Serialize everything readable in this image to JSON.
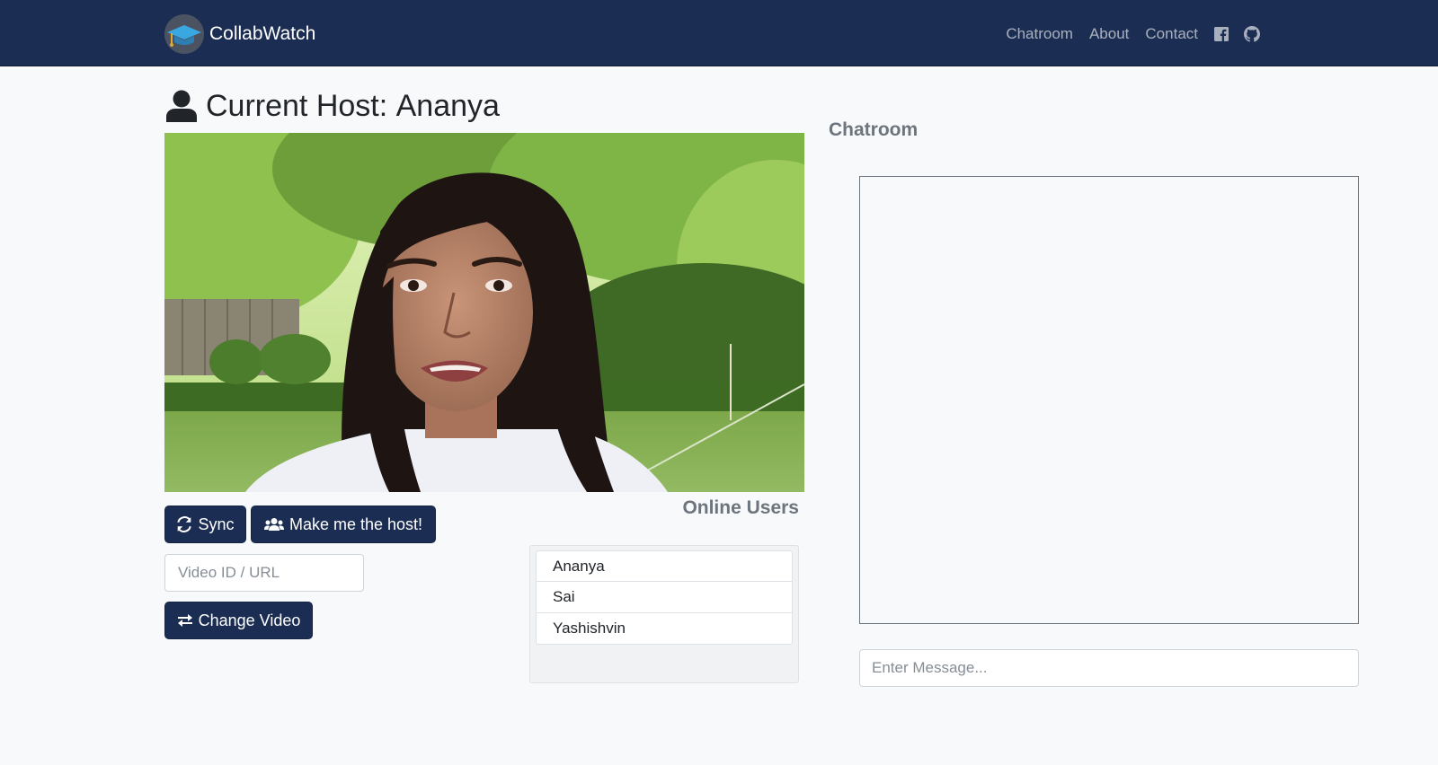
{
  "navbar": {
    "brand_name": "CollabWatch",
    "links": [
      "Chatroom",
      "About",
      "Contact"
    ],
    "icons": [
      "facebook-icon",
      "github-icon"
    ]
  },
  "host": {
    "prefix": "Current Host: ",
    "name": "Ananya",
    "icon": "person-icon"
  },
  "controls": {
    "sync_label": "Sync",
    "make_host_label": "Make me the host!",
    "video_input_placeholder": "Video ID / URL",
    "change_video_label": "Change Video"
  },
  "online_users": {
    "title": "Online Users",
    "users": [
      "Ananya",
      "Sai",
      "Yashishvin"
    ]
  },
  "chatroom": {
    "title": "Chatroom",
    "input_placeholder": "Enter Message..."
  },
  "colors": {
    "navbar": "#1b2d52",
    "button": "#1b2d52",
    "background": "#f8f9fa",
    "muted_heading": "#6c757d"
  }
}
